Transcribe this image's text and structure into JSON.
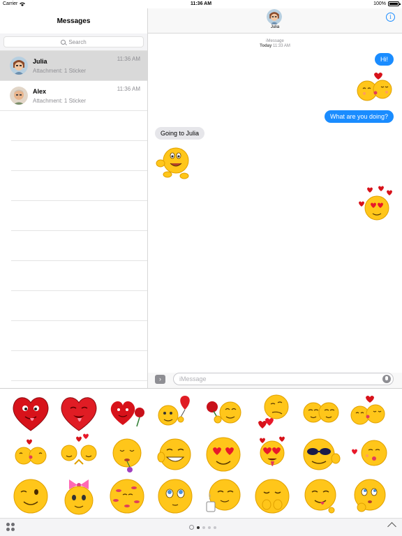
{
  "status_bar": {
    "carrier": "Carrier",
    "time": "11:36 AM",
    "battery": "100%"
  },
  "sidebar": {
    "title": "Messages",
    "search_placeholder": "Search",
    "conversations": [
      {
        "name": "Julia",
        "preview": "Attachment: 1 Sticker",
        "time": "11:36 AM",
        "selected": true
      },
      {
        "name": "Alex",
        "preview": "Attachment: 1 Sticker",
        "time": "11:36 AM",
        "selected": false
      }
    ]
  },
  "chat": {
    "contact_name": "Julia",
    "service_label": "iMessage",
    "service_time_day": "Today",
    "service_time": "11:33 AM",
    "messages": [
      {
        "direction": "out",
        "type": "text",
        "text": "Hi!"
      },
      {
        "direction": "out",
        "type": "sticker",
        "sticker": "kissing-couple-sticker"
      },
      {
        "direction": "out",
        "type": "text",
        "text": "What are you doing?"
      },
      {
        "direction": "in",
        "type": "text",
        "text": "Going to Julia"
      },
      {
        "direction": "in",
        "type": "sticker",
        "sticker": "running-smiley-sticker"
      },
      {
        "direction": "out",
        "type": "sticker",
        "sticker": "heart-eyes-smiley-sticker"
      }
    ],
    "input_placeholder": "iMessage"
  },
  "stickers": [
    "heart-tongue-sticker",
    "heart-kiss-sticker",
    "heart-with-rose-sticker",
    "smiley-with-balloon-sticker",
    "rose-giving-smiley-sticker",
    "smiley-holding-hearts-sticker",
    "two-smileys-sticker",
    "kissing-pair-sticker",
    "smooching-smileys-sticker",
    "love-dancing-smileys-sticker",
    "shy-smiley-with-flower-sticker",
    "cheeky-grin-sticker",
    "heart-eyes-sticker",
    "hearts-tongue-sticker",
    "sunglasses-thumbs-up-sticker",
    "blowing-kiss-sticker",
    "winking-smiley-sticker",
    "girl-smiley-with-bow-sticker",
    "lipstick-kisses-sticker",
    "hopeful-smiley-sticker",
    "smiley-with-coffee-sticker",
    "giggling-smiley-sticker",
    "teasing-smiley-sticker",
    "thinking-smiley-sticker"
  ],
  "drawer": {
    "page_count": 4,
    "active_page": 1
  },
  "colors": {
    "accent": "#1a8cff",
    "incoming_bubble": "#e6e6ea",
    "smiley": "#ffc61a",
    "heart": "#d7121a"
  }
}
